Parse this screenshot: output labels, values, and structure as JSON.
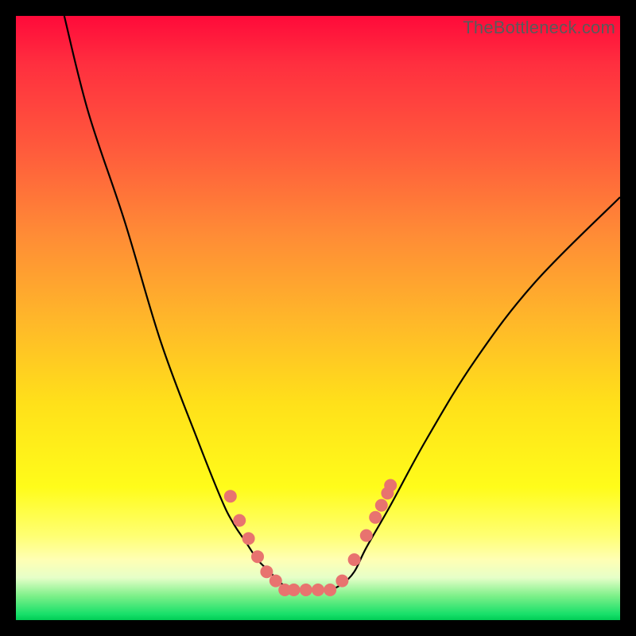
{
  "watermark": "TheBottleneck.com",
  "chart_data": {
    "type": "line",
    "title": "",
    "xlabel": "",
    "ylabel": "",
    "xlim": [
      0,
      100
    ],
    "ylim": [
      0,
      100
    ],
    "series": [
      {
        "name": "bottleneck-curve",
        "x": [
          8,
          12,
          18,
          24,
          30,
          34,
          36,
          38,
          40,
          42,
          44,
          46,
          48,
          50,
          52,
          54,
          56,
          58,
          62,
          68,
          76,
          86,
          100
        ],
        "y": [
          100,
          84,
          66,
          46,
          30,
          20,
          16,
          13,
          10,
          8,
          6,
          5,
          5,
          5,
          5,
          6,
          8,
          12,
          19,
          30,
          43,
          56,
          70
        ]
      }
    ],
    "markers": [
      {
        "name": "left-marker",
        "x": 35.5,
        "y": 20.5
      },
      {
        "name": "left-marker",
        "x": 37,
        "y": 16.5
      },
      {
        "name": "left-marker",
        "x": 38.5,
        "y": 13.5
      },
      {
        "name": "left-marker",
        "x": 40,
        "y": 10.5
      },
      {
        "name": "left-marker",
        "x": 41.5,
        "y": 8
      },
      {
        "name": "left-marker",
        "x": 43,
        "y": 6.5
      },
      {
        "name": "floor-marker",
        "x": 44.5,
        "y": 5
      },
      {
        "name": "floor-marker",
        "x": 46,
        "y": 5
      },
      {
        "name": "floor-marker",
        "x": 48,
        "y": 5
      },
      {
        "name": "floor-marker",
        "x": 50,
        "y": 5
      },
      {
        "name": "floor-marker",
        "x": 52,
        "y": 5
      },
      {
        "name": "right-marker",
        "x": 54,
        "y": 6.5
      },
      {
        "name": "right-marker",
        "x": 56,
        "y": 10
      },
      {
        "name": "right-marker",
        "x": 58,
        "y": 14
      },
      {
        "name": "right-marker",
        "x": 59.5,
        "y": 17
      },
      {
        "name": "right-marker",
        "x": 60.5,
        "y": 19
      },
      {
        "name": "right-marker",
        "x": 61.5,
        "y": 21
      },
      {
        "name": "right-marker",
        "x": 62,
        "y": 22.3
      }
    ],
    "colors": {
      "curve": "#000000",
      "marker_fill": "#e8736f",
      "background_top": "#ff0a3a",
      "background_bottom": "#00cc55"
    }
  }
}
